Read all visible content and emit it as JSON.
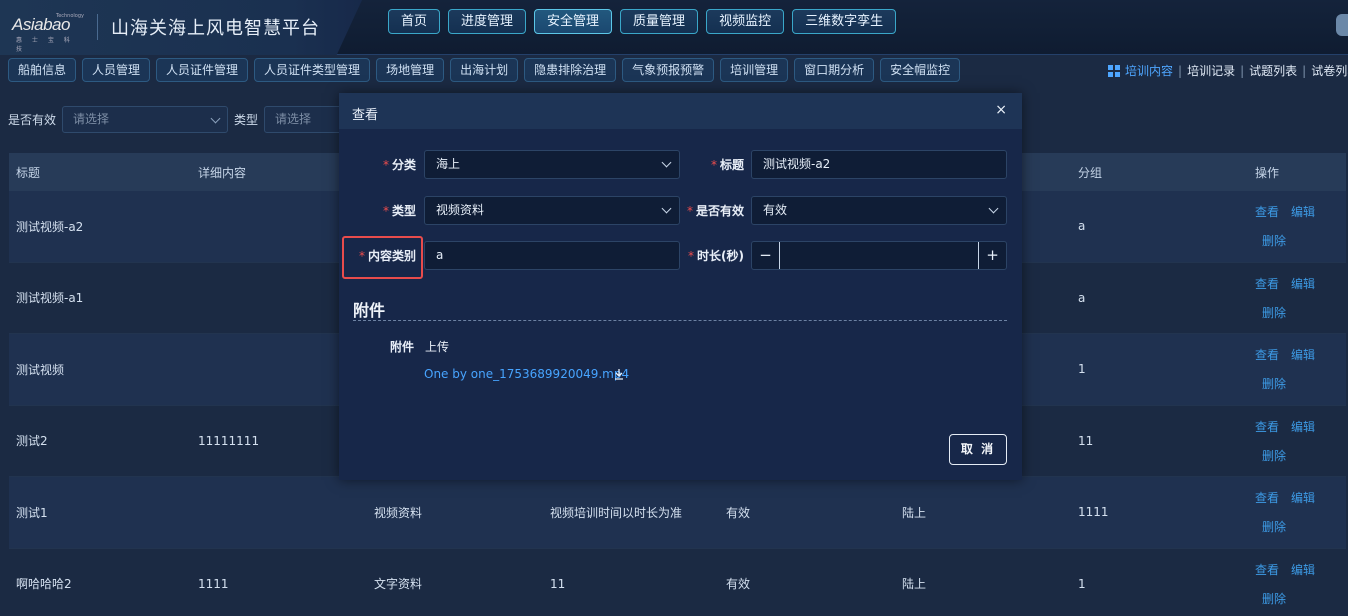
{
  "brand": {
    "logo_text": "Asiabao",
    "logo_tech": "Technology",
    "logo_sub": "惠 士 宝 科 技",
    "platform_title": "山海关海上风电智慧平台"
  },
  "top_nav": [
    {
      "label": "首页",
      "active": false
    },
    {
      "label": "进度管理",
      "active": false
    },
    {
      "label": "安全管理",
      "active": true
    },
    {
      "label": "质量管理",
      "active": false
    },
    {
      "label": "视频监控",
      "active": false
    },
    {
      "label": "三维数字孪生",
      "active": false
    }
  ],
  "sub_nav": [
    "船舶信息",
    "人员管理",
    "人员证件管理",
    "人员证件类型管理",
    "场地管理",
    "出海计划",
    "隐患排除治理",
    "气象预报预警",
    "培训管理",
    "窗口期分析",
    "安全帽监控"
  ],
  "right_links": [
    {
      "label": "培训内容",
      "active": true
    },
    {
      "label": "培训记录",
      "active": false
    },
    {
      "label": "试题列表",
      "active": false
    },
    {
      "label": "试卷列表",
      "active": false
    }
  ],
  "separator": "|",
  "filter": {
    "valid_label": "是否有效",
    "valid_placeholder": "请选择",
    "type_label": "类型",
    "type_placeholder": "请选择"
  },
  "table": {
    "headers": {
      "title": "标题",
      "detail": "详细内容",
      "group": "分组",
      "ops": "操作"
    },
    "rows": [
      {
        "title": "测试视频-a2",
        "detail": "",
        "type": "",
        "note": "",
        "valid": "",
        "place": "",
        "group": "a"
      },
      {
        "title": "测试视频-a1",
        "detail": "",
        "type": "",
        "note": "",
        "valid": "",
        "place": "",
        "group": "a"
      },
      {
        "title": "测试视频",
        "detail": "",
        "type": "",
        "note": "",
        "valid": "",
        "place": "",
        "group": "1"
      },
      {
        "title": "测试2",
        "detail": "11111111",
        "type": "",
        "note": "",
        "valid": "",
        "place": "",
        "group": "11"
      },
      {
        "title": "测试1",
        "detail": "",
        "type": "视频资料",
        "note": "视频培训时间以时长为准",
        "valid": "有效",
        "place": "陆上",
        "group": "1111"
      },
      {
        "title": "啊哈哈哈2",
        "detail": "1111",
        "type": "文字资料",
        "note": "11",
        "valid": "有效",
        "place": "陆上",
        "group": "1"
      }
    ],
    "op_view": "查看",
    "op_edit": "编辑",
    "op_delete": "删除"
  },
  "modal": {
    "title": "查看",
    "close": "×",
    "required_mark": "*",
    "category_label": "分类",
    "category_value": "海上",
    "title_label": "标题",
    "title_value": "测试视频-a2",
    "type_label": "类型",
    "type_value": "视频资料",
    "valid_label": "是否有效",
    "valid_value": "有效",
    "content_type_label": "内容类别",
    "content_type_value": "a",
    "duration_label": "时长(秒)",
    "duration_value": "",
    "minus": "−",
    "plus": "+",
    "section_title": "附件",
    "attach_label": "附件",
    "upload_text": "上传",
    "file_name": "One by one_1753689920049.mp4",
    "cancel_label": "取 消"
  }
}
